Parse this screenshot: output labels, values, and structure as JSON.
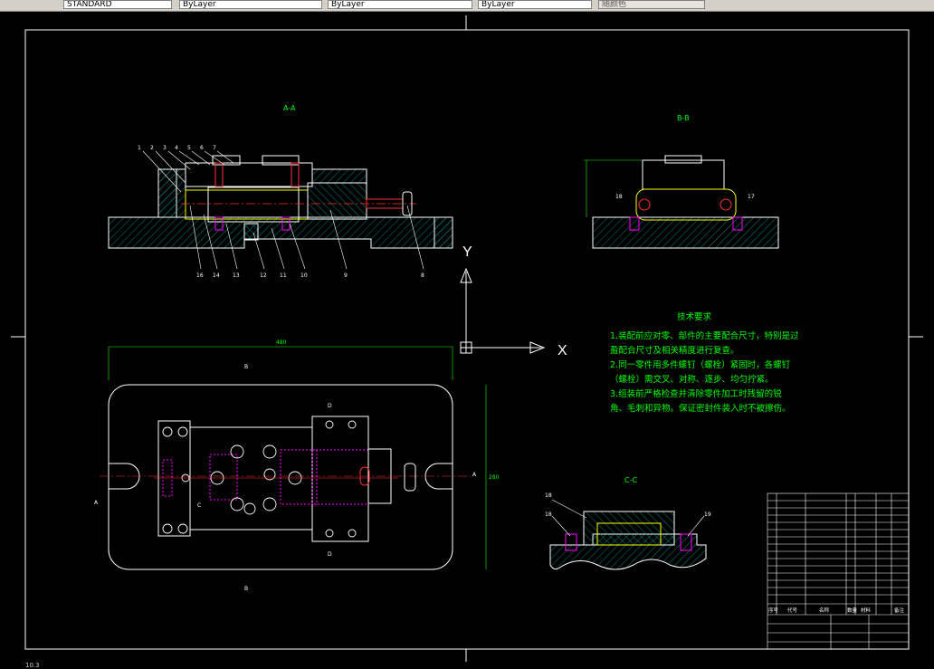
{
  "toolbar": {
    "fields": [
      {
        "name": "textstyle-combo",
        "value": "STANDARD"
      },
      {
        "name": "color-combo",
        "value": "ByLayer"
      },
      {
        "name": "linetype-combo",
        "value": "ByLayer"
      },
      {
        "name": "lineweight-combo",
        "value": "ByLayer"
      },
      {
        "name": "plotstyle-combo",
        "value": "随颜色"
      }
    ]
  },
  "drawing": {
    "view_aa_title": "A-A",
    "view_bb_title": "B-B",
    "view_cc_title": "C-C",
    "callouts_top": [
      "1",
      "2",
      "3",
      "4",
      "5",
      "6",
      "7"
    ],
    "callouts_bottom": [
      "16",
      "14",
      "13",
      "12",
      "11",
      "10",
      "9",
      "8"
    ],
    "callouts_bb": [
      "18",
      "17"
    ],
    "callouts_cc": [
      "18",
      "18",
      "19"
    ],
    "dim_plan_width": "480",
    "dim_plan_height": "280",
    "section_marks": {
      "a": "A",
      "b": "B",
      "c": "C",
      "d": "D"
    },
    "ucs": {
      "x_label": "X",
      "y_label": "Y"
    },
    "tech_title": "技术要求",
    "tech_lines": [
      "1.装配前应对零、部件的主要配合尺寸，特别是过",
      "盈配合尺寸及相关精度进行复查。",
      "2.同一零件用多件螺钉（螺栓）紧固时，各螺钉",
      "（螺栓）需交叉、对称、逐步、均匀拧紧。",
      "3.组装前严格检查并清除零件加工时残留的锐",
      "角、毛刺和异物。保证密封件装入时不被擦伤。"
    ],
    "title_block": {
      "h_seq": "序号",
      "h_code": "代号",
      "h_name": "名称",
      "h_qty": "数量",
      "h_material": "材料",
      "h_remark": "备注"
    }
  },
  "colors": {
    "background": "#000000",
    "white": "#ffffff",
    "green": "#00ff00",
    "yellow": "#ffff00",
    "magenta": "#ff00ff",
    "red": "#ff3030",
    "cyan": "#00c8c8",
    "hatch": "#00a0a0"
  },
  "status": {
    "coords": "10.3"
  }
}
